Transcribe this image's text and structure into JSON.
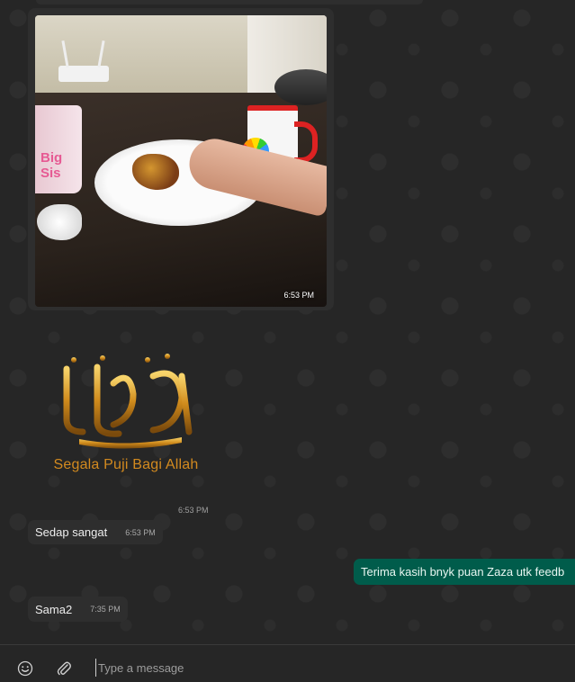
{
  "conversation": {
    "image_message": {
      "time": "6:53 PM",
      "mug_text": "Big Sis"
    },
    "sticker": {
      "caption": "Segala Puji Bagi Allah",
      "time": "6:53 PM"
    },
    "messages": [
      {
        "text": "Sedap sangat",
        "time": "6:53 PM",
        "direction": "incoming"
      },
      {
        "text": "Terima kasih bnyk puan Zaza utk feedb",
        "time": "",
        "direction": "outgoing"
      },
      {
        "text": "Sama2",
        "time": "7:35 PM",
        "direction": "incoming"
      }
    ]
  },
  "composer": {
    "placeholder": "Type a message",
    "value": "",
    "emoji_icon": "smiley-icon",
    "attach_icon": "paperclip-icon"
  },
  "colors": {
    "chat_background": "#262626",
    "incoming_bubble": "#2e2e2e",
    "outgoing_bubble": "#005c4b",
    "sticker_gold": "#d38a1f"
  }
}
